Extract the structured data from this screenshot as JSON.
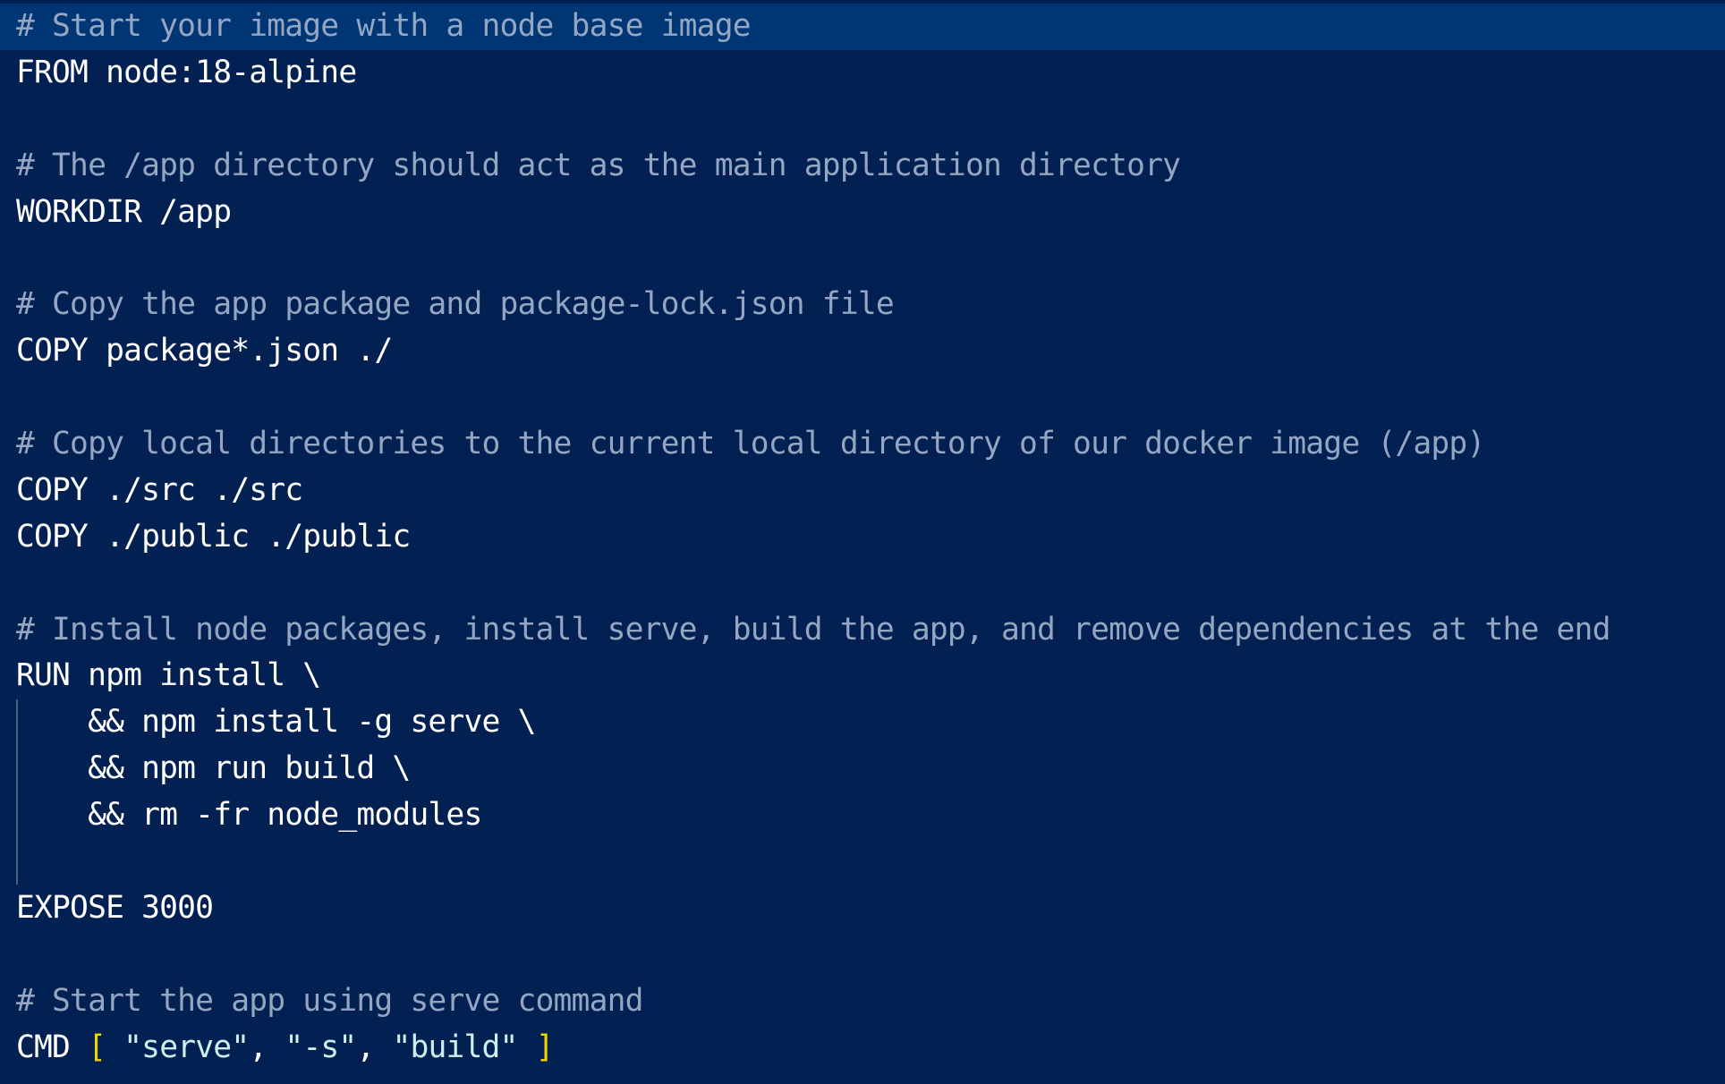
{
  "editor": {
    "lines": [
      {
        "type": "comment",
        "text": "# Start your image with a node base image",
        "active": true
      },
      {
        "type": "instr",
        "kw": "FROM",
        "rest": " node:18-alpine"
      },
      {
        "type": "blank"
      },
      {
        "type": "comment",
        "text": "# The /app directory should act as the main application directory"
      },
      {
        "type": "instr",
        "kw": "WORKDIR",
        "rest": " /app"
      },
      {
        "type": "blank"
      },
      {
        "type": "comment",
        "text": "# Copy the app package and package-lock.json file"
      },
      {
        "type": "instr",
        "kw": "COPY",
        "rest": " package*.json ./"
      },
      {
        "type": "blank"
      },
      {
        "type": "comment",
        "text": "# Copy local directories to the current local directory of our docker image (/app)"
      },
      {
        "type": "instr",
        "kw": "COPY",
        "rest": " ./src ./src"
      },
      {
        "type": "instr",
        "kw": "COPY",
        "rest": " ./public ./public"
      },
      {
        "type": "blank"
      },
      {
        "type": "comment",
        "text": "# Install node packages, install serve, build the app, and remove dependencies at the end"
      },
      {
        "type": "instr",
        "kw": "RUN",
        "rest": " npm install \\"
      },
      {
        "type": "cont",
        "text": "    && npm install -g serve \\"
      },
      {
        "type": "cont",
        "text": "    && npm run build \\"
      },
      {
        "type": "cont",
        "text": "    && rm -fr node_modules"
      },
      {
        "type": "blank"
      },
      {
        "type": "instr",
        "kw": "EXPOSE",
        "rest": " 3000"
      },
      {
        "type": "blank"
      },
      {
        "type": "comment",
        "text": "# Start the app using serve command"
      },
      {
        "type": "cmd",
        "kw": "CMD",
        "sp1": " ",
        "open": "[",
        "sp2": " ",
        "s1": "\"serve\"",
        "c1": ", ",
        "s2": "\"-s\"",
        "c2": ", ",
        "s3": "\"build\"",
        "sp3": " ",
        "close": "]"
      }
    ]
  },
  "colors": {
    "background": "#022152",
    "active_line": "#003674",
    "comment": "#94a6c2",
    "keyword": "#ffffff",
    "bracket": "#f1d700",
    "string": "#c9f2ee"
  }
}
